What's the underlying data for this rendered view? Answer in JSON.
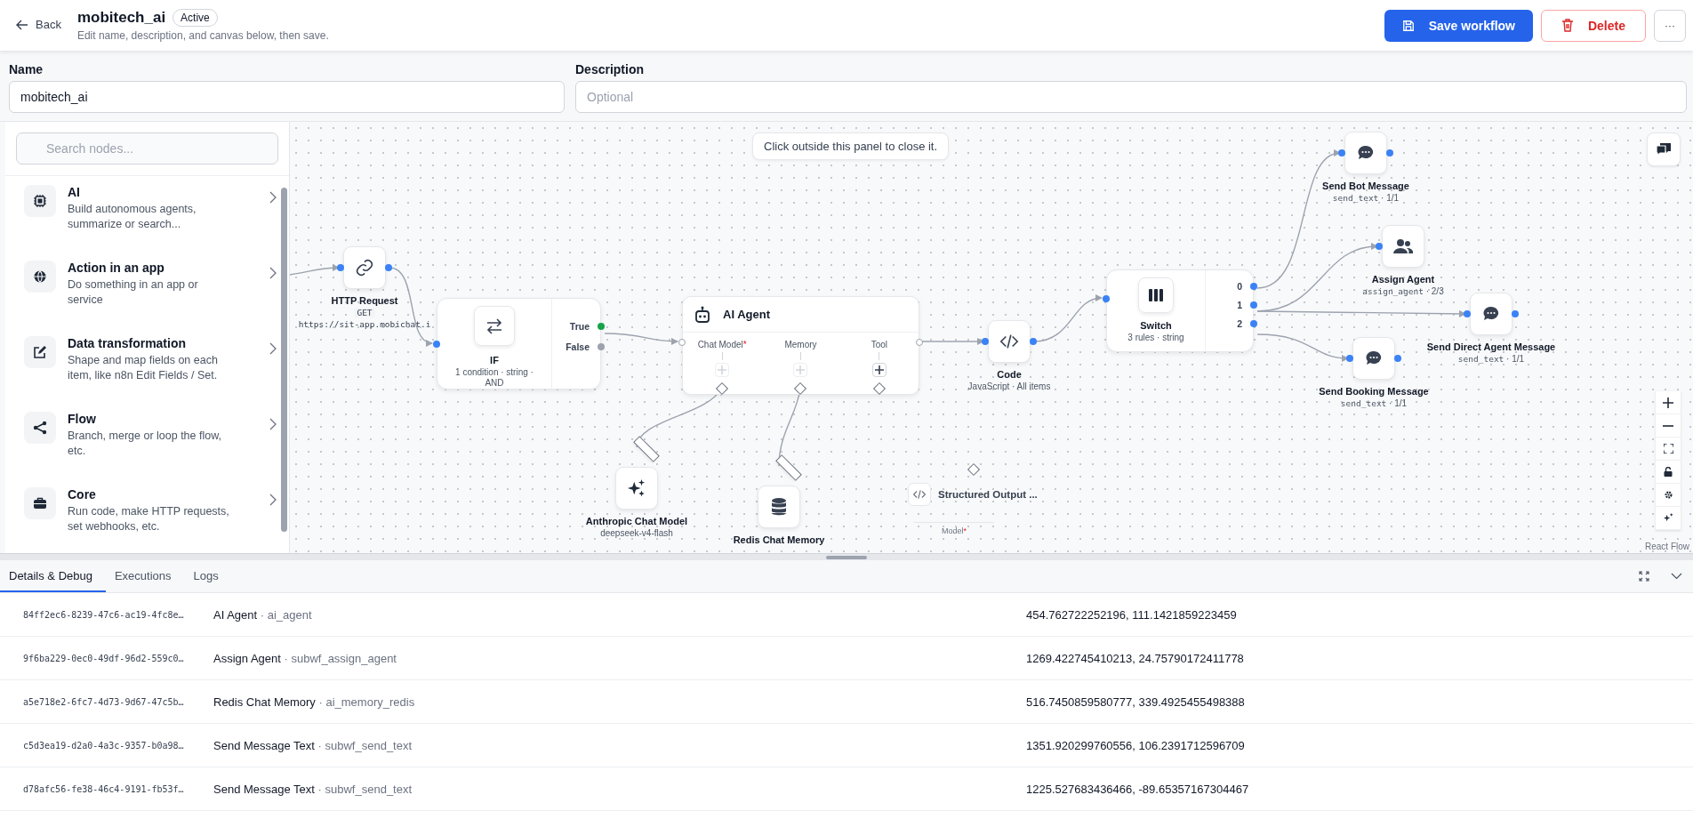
{
  "header": {
    "back": "Back",
    "title": "mobitech_ai",
    "status": "Active",
    "subtitle": "Edit name, description, and canvas below, then save.",
    "save": "Save workflow",
    "delete": "Delete",
    "more": "···"
  },
  "form": {
    "name_label": "Name",
    "name_value": "mobitech_ai",
    "description_label": "Description",
    "description_placeholder": "Optional"
  },
  "palette": {
    "search_placeholder": "Search nodes...",
    "categories": [
      {
        "kind": "ai",
        "title": "AI",
        "description": "Build autonomous agents, summarize or search..."
      },
      {
        "kind": "app",
        "title": "Action in an app",
        "description": "Do something in an app or service"
      },
      {
        "kind": "transform",
        "title": "Data transformation",
        "description": "Shape and map fields on each item, like n8n Edit Fields / Set."
      },
      {
        "kind": "flow",
        "title": "Flow",
        "description": "Branch, merge or loop the flow, etc."
      },
      {
        "kind": "core",
        "title": "Core",
        "description": "Run code, make HTTP requests, set webhooks, etc."
      }
    ]
  },
  "canvas": {
    "hint": "Click outside this panel to close it.",
    "attribution": "React Flow",
    "nodes": [
      {
        "kind": "http",
        "title": "HTTP Request",
        "method": "GET",
        "url": "https://sit-app.mobichat.i"
      },
      {
        "kind": "if",
        "title": "IF",
        "subtitle": "1 condition · string · AND",
        "outputs": [
          {
            "label": "True",
            "color": "#16a34a"
          },
          {
            "label": "False",
            "color": "#9ca3af"
          }
        ]
      },
      {
        "kind": "agent",
        "title": "AI Agent",
        "slots": [
          {
            "label": "Chat Model",
            "required_mark": "*",
            "disabled": true
          },
          {
            "label": "Memory",
            "disabled": true
          },
          {
            "label": "Tool",
            "disabled": false
          }
        ]
      },
      {
        "kind": "code",
        "title": "Code",
        "subtitle": "JavaScript · All items"
      },
      {
        "kind": "switch",
        "title": "Switch",
        "subtitle": "3 rules · string",
        "outputs": [
          {
            "label": "0"
          },
          {
            "label": "1"
          },
          {
            "label": "2"
          }
        ]
      },
      {
        "kind": "message",
        "title": "Send Bot Message",
        "code": "send_text",
        "detail": "· 1/1"
      },
      {
        "kind": "assign",
        "title": "Assign Agent",
        "code": "assign_agent",
        "detail": "· 2/3"
      },
      {
        "kind": "message",
        "title": "Send Direct Agent Message",
        "code": "send_text",
        "detail": "· 1/1"
      },
      {
        "kind": "message",
        "title": "Send Booking Message",
        "code": "send_text",
        "detail": "· 1/1"
      },
      {
        "kind": "model",
        "title": "Anthropic Chat Model",
        "subtitle": "deepseek-v4-flash"
      },
      {
        "kind": "memory",
        "title": "Redis Chat Memory"
      },
      {
        "kind": "parser",
        "title": "Structured Output ...",
        "slot_label": "Model",
        "required_mark": "*"
      }
    ]
  },
  "debug": {
    "tabs": [
      {
        "label": "Details & Debug",
        "selected": true
      },
      {
        "label": "Executions",
        "selected": false
      },
      {
        "label": "Logs",
        "selected": false
      }
    ],
    "rows": [
      {
        "id": "84ff2ec6-8239-47c6-ac19-4fc8e…",
        "name": "AI Agent",
        "key": "· ai_agent",
        "position": "454.762722252196, 111.1421859223459"
      },
      {
        "id": "9f6ba229-0ec0-49df-96d2-559c0…",
        "name": "Assign Agent",
        "key": "· subwf_assign_agent",
        "position": "1269.422745410213, 24.75790172411778"
      },
      {
        "id": "a5e718e2-6fc7-4d73-9d67-47c5b…",
        "name": "Redis Chat Memory",
        "key": "· ai_memory_redis",
        "position": "516.7450859580777, 339.4925455498388"
      },
      {
        "id": "c5d3ea19-d2a0-4a3c-9357-b0a98…",
        "name": "Send Message Text",
        "key": "· subwf_send_text",
        "position": "1351.920299760556, 106.2391712596709"
      },
      {
        "id": "d78afc56-fe38-46c4-9191-fb53f…",
        "name": "Send Message Text",
        "key": "· subwf_send_text",
        "position": "1225.527683436466, -89.65357167304467"
      }
    ]
  }
}
